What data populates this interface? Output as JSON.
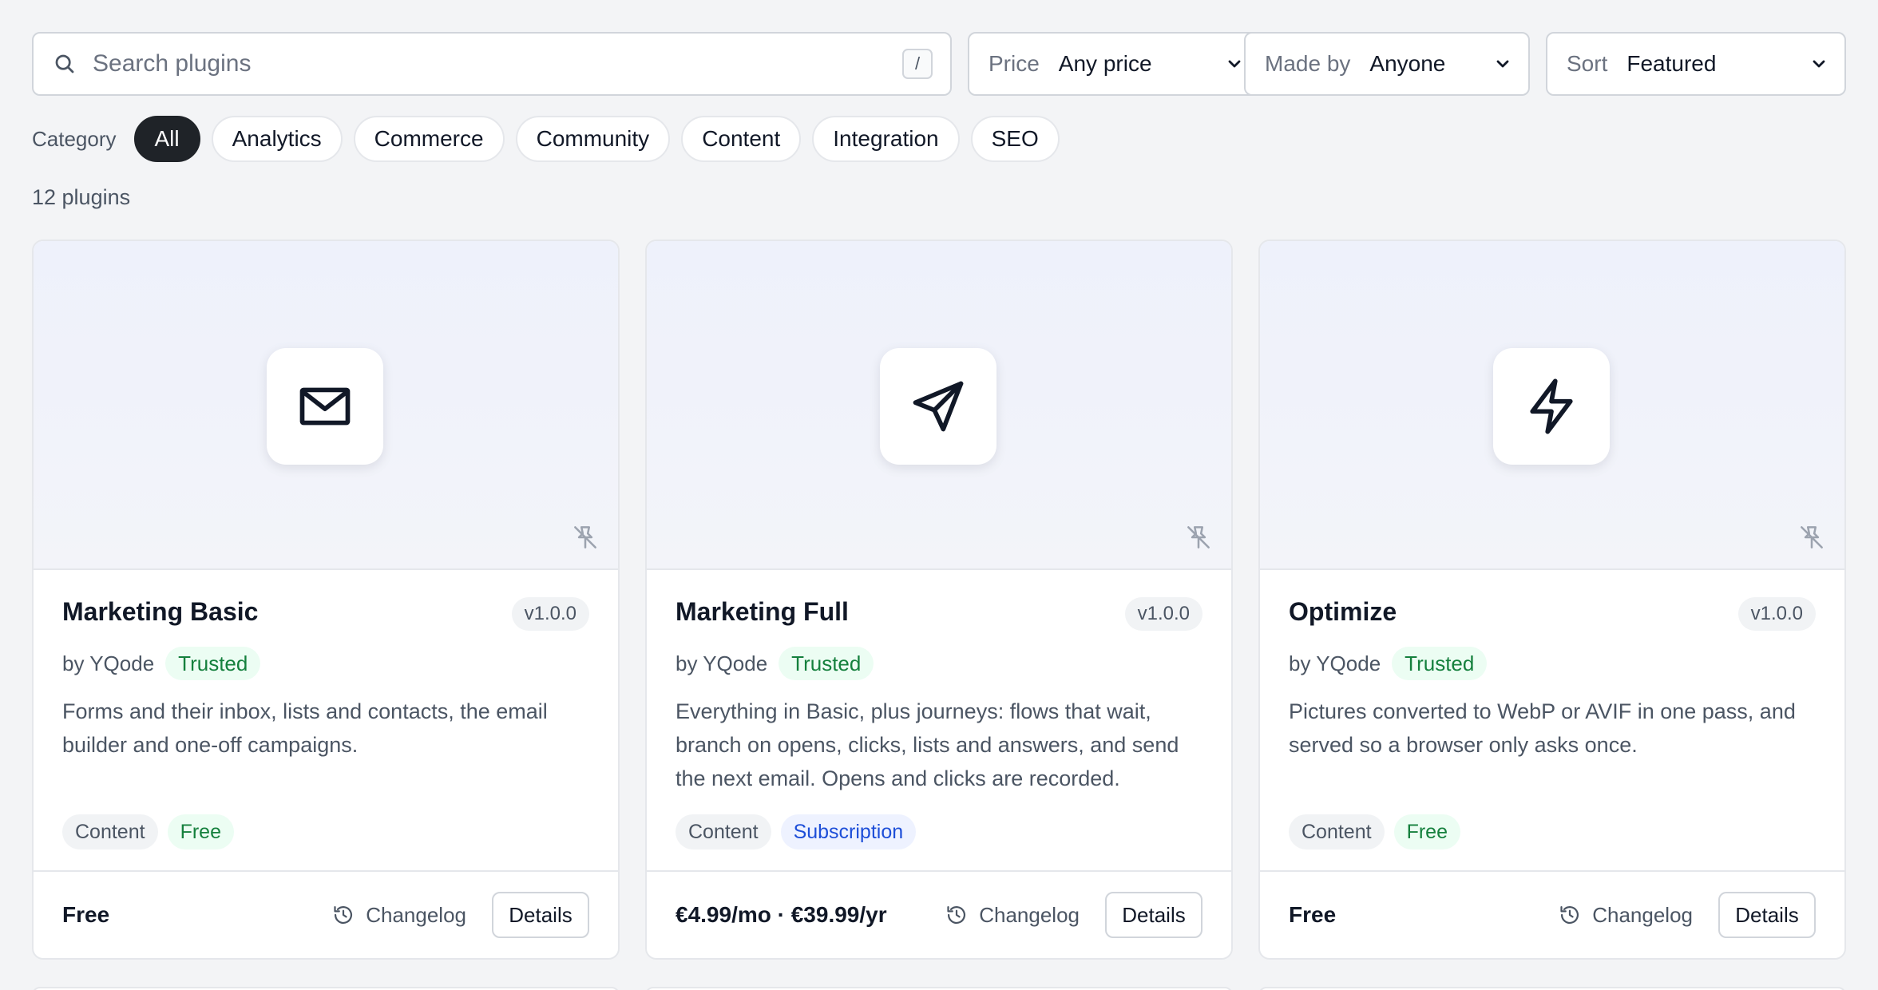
{
  "search": {
    "placeholder": "Search plugins",
    "value": "",
    "shortcut": "/"
  },
  "filters": {
    "price": {
      "label": "Price",
      "value": "Any price"
    },
    "made_by": {
      "label": "Made by",
      "value": "Anyone"
    },
    "sort": {
      "label": "Sort",
      "value": "Featured"
    }
  },
  "category": {
    "label": "Category",
    "items": [
      "All",
      "Analytics",
      "Commerce",
      "Community",
      "Content",
      "Integration",
      "SEO"
    ],
    "active": "All"
  },
  "count_text": "12 plugins",
  "cards": [
    {
      "icon": "mail-icon",
      "title": "Marketing Basic",
      "version": "v1.0.0",
      "by": "by YQode",
      "trust": "Trusted",
      "description": "Forms and their inbox, lists and contacts, the email builder and one-off campaigns.",
      "tags": [
        {
          "text": "Content",
          "kind": "neutral"
        },
        {
          "text": "Free",
          "kind": "free"
        }
      ],
      "price": "Free",
      "changelog": "Changelog",
      "details": "Details"
    },
    {
      "icon": "send-icon",
      "title": "Marketing Full",
      "version": "v1.0.0",
      "by": "by YQode",
      "trust": "Trusted",
      "description": "Everything in Basic, plus journeys: flows that wait, branch on opens, clicks, lists and answers, and send the next email. Opens and clicks are recorded.",
      "tags": [
        {
          "text": "Content",
          "kind": "neutral"
        },
        {
          "text": "Subscription",
          "kind": "sub"
        }
      ],
      "price": "€4.99/mo · €39.99/yr",
      "changelog": "Changelog",
      "details": "Details"
    },
    {
      "icon": "lightning-icon",
      "title": "Optimize",
      "version": "v1.0.0",
      "by": "by YQode",
      "trust": "Trusted",
      "description": "Pictures converted to WebP or AVIF in one pass, and served so a browser only asks once.",
      "tags": [
        {
          "text": "Content",
          "kind": "neutral"
        },
        {
          "text": "Free",
          "kind": "free"
        }
      ],
      "price": "Free",
      "changelog": "Changelog",
      "details": "Details"
    }
  ]
}
